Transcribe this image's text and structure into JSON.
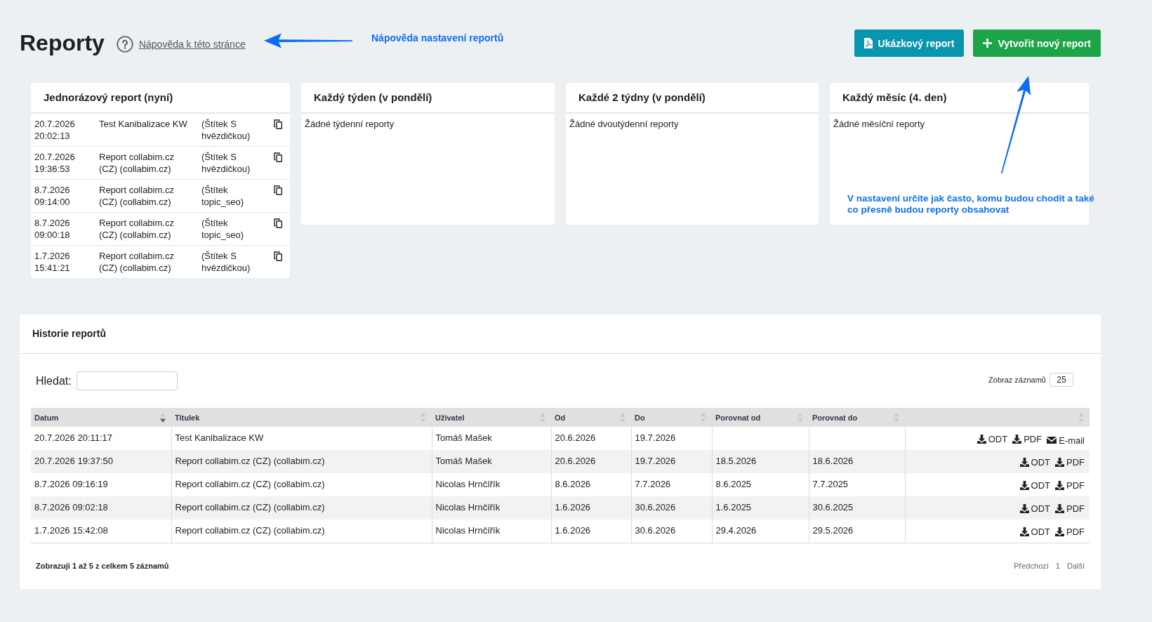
{
  "page": {
    "title": "Reporty",
    "help_link": "Nápověda k této stránce"
  },
  "actions": [
    {
      "kind": "sample",
      "label": "Ukázkový report"
    },
    {
      "kind": "create",
      "label": "Vytvořit nový report"
    }
  ],
  "schedules": [
    {
      "title": "Jednorázový report (nyní)",
      "reports": [
        {
          "date": "20.7.2026 20:02:13",
          "title": "Test Kanibalizace KW",
          "tag": "(Štítek S hvězdičkou)"
        },
        {
          "date": "20.7.2026 19:36:53",
          "title": "Report collabim.cz (CZ) (collabim.cz)",
          "tag": "(Štítek S hvězdičkou)"
        },
        {
          "date": "8.7.2026 09:14:00",
          "title": "Report collabim.cz (CZ) (collabim.cz)",
          "tag": "(Štítek topic_seo)"
        },
        {
          "date": "8.7.2026 09:00:18",
          "title": "Report collabim.cz (CZ) (collabim.cz)",
          "tag": "(Štítek topic_seo)"
        },
        {
          "date": "1.7.2026 15:41:21",
          "title": "Report collabim.cz (CZ) (collabim.cz)",
          "tag": "(Štítek S hvězdičkou)"
        }
      ]
    },
    {
      "title": "Každý týden (v pondělí)",
      "empty_text": "Žádné týdenní reporty"
    },
    {
      "title": "Každé 2 týdny (v pondělí)",
      "empty_text": "Žádné dvoutýdenní reporty"
    },
    {
      "title": "Každý měsíc (4. den)",
      "empty_text": "Žádné měsíční reporty"
    }
  ],
  "history": {
    "title": "Historie reportů",
    "search": {
      "label": "Hledat:"
    },
    "page_size": {
      "label": "Zobraz záznamů",
      "value": "25"
    },
    "table": {
      "columns": [
        {
          "label": "Datum",
          "sorted": true
        },
        {
          "label": "Titulek",
          "sorted": false
        },
        {
          "label": "Uživatel",
          "sorted": false
        },
        {
          "label": "Od",
          "sorted": false
        },
        {
          "label": "Do",
          "sorted": false
        },
        {
          "label": "Porovnat od",
          "sorted": false
        },
        {
          "label": "Porovnat do",
          "sorted": false
        },
        {
          "sorted": false
        }
      ],
      "rows": [
        {
          "date": "20.7.2026 20:11:17",
          "title": "Test Kanibalizace KW",
          "user": "Tomáš Mašek",
          "from": "20.6.2026",
          "to": "19.7.2026",
          "actions": [
            {
              "kind": "download",
              "label": "ODT"
            },
            {
              "kind": "download",
              "label": "PDF"
            },
            {
              "kind": "email",
              "label": "E-mail"
            }
          ]
        },
        {
          "date": "20.7.2026 19:37:50",
          "title": "Report collabim.cz (CZ) (collabim.cz)",
          "user": "Tomáš Mašek",
          "from": "20.6.2026",
          "to": "19.7.2026",
          "compare_from": "18.5.2026",
          "compare_to": "18.6.2026",
          "actions": [
            {
              "kind": "download",
              "label": "ODT"
            },
            {
              "kind": "download",
              "label": "PDF"
            }
          ]
        },
        {
          "date": "8.7.2026 09:16:19",
          "title": "Report collabim.cz (CZ) (collabim.cz)",
          "user": "Nicolas Hrnčířík",
          "from": "8.6.2026",
          "to": "7.7.2026",
          "compare_from": "8.6.2025",
          "compare_to": "7.7.2025",
          "actions": [
            {
              "kind": "download",
              "label": "ODT"
            },
            {
              "kind": "download",
              "label": "PDF"
            }
          ]
        },
        {
          "date": "8.7.2026 09:02:18",
          "title": "Report collabim.cz (CZ) (collabim.cz)",
          "user": "Nicolas Hrnčířík",
          "from": "1.6.2026",
          "to": "30.6.2026",
          "compare_from": "1.6.2025",
          "compare_to": "30.6.2025",
          "actions": [
            {
              "kind": "download",
              "label": "ODT"
            },
            {
              "kind": "download",
              "label": "PDF"
            }
          ]
        },
        {
          "date": "1.7.2026 15:42:08",
          "title": "Report collabim.cz (CZ) (collabim.cz)",
          "user": "Nicolas Hrnčířík",
          "from": "1.6.2026",
          "to": "30.6.2026",
          "compare_from": "29.4.2026",
          "compare_to": "29.5.2026",
          "actions": [
            {
              "kind": "download",
              "label": "ODT"
            },
            {
              "kind": "download",
              "label": "PDF"
            }
          ]
        }
      ]
    },
    "info": "Zobrazuji 1 až 5 z celkem 5 záznamů",
    "pagination": [
      "Předchozí",
      "1",
      "Další"
    ]
  },
  "annotations": [
    {
      "kind": "left-arrow",
      "text": "Nápověda nastavení reportů"
    },
    {
      "kind": "up-arrow",
      "text": "V nastavení určíte jak často, komu budou chodit a také co přesně budou reporty obsahovat"
    }
  ]
}
